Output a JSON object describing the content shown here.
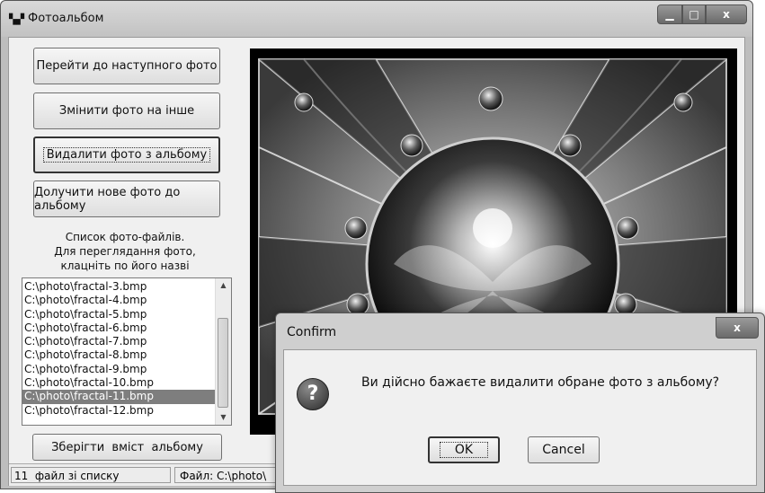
{
  "window": {
    "title": "Фотоальбом",
    "icon": "app-icon",
    "minimize_glyph": "▁",
    "maximize_glyph": "□",
    "close_glyph": "x"
  },
  "buttons": {
    "next": "Перейти до наступного фото",
    "change": "Змінити фото на інше",
    "delete": "Видалити фото з альбому",
    "add": "Долучити нове фото до альбому",
    "save": "Зберігти  вміст  альбому"
  },
  "caption": {
    "line1": "Список фото-файлів.",
    "line2": "Для переглядання фото,",
    "line3": "клацніть по його назві"
  },
  "files": [
    "C:\\photo\\fractal-3.bmp",
    "C:\\photo\\fractal-4.bmp",
    "C:\\photo\\fractal-5.bmp",
    "C:\\photo\\fractal-6.bmp",
    "C:\\photo\\fractal-7.bmp",
    "C:\\photo\\fractal-8.bmp",
    "C:\\photo\\fractal-9.bmp",
    "C:\\photo\\fractal-10.bmp",
    "C:\\photo\\fractal-11.bmp",
    "C:\\photo\\fractal-12.bmp"
  ],
  "selected_file": "C:\\photo\\fractal-11.bmp",
  "statusbar": {
    "count": "11  файл зі списку",
    "file": "Файл: C:\\photo\\"
  },
  "dialog": {
    "title": "Confirm",
    "message": "Ви дійсно бажаєте видалити обране фото з альбому?",
    "ok": "OK",
    "cancel": "Cancel",
    "icon_glyph": "?",
    "close_glyph": "x"
  },
  "colors": {
    "selection": "#7e7e7e",
    "photo_background": "#000000"
  }
}
